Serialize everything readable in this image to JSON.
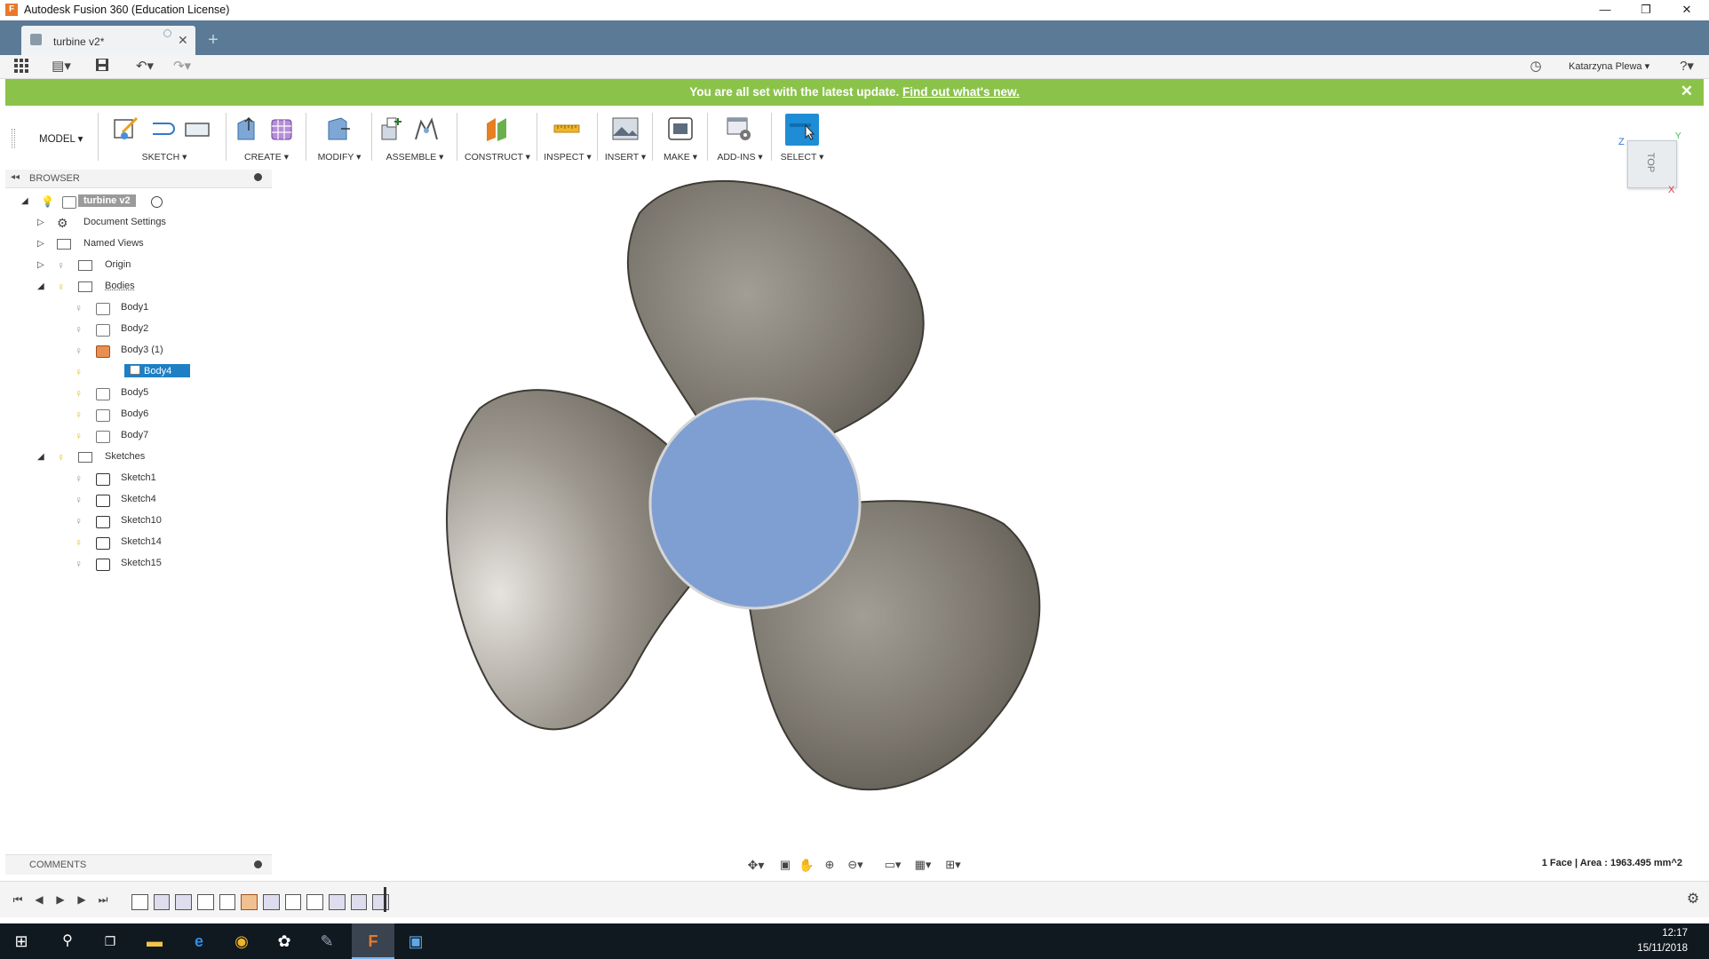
{
  "window": {
    "title": "Autodesk Fusion 360 (Education License)",
    "app_letter": "F"
  },
  "tab": {
    "label": "turbine v2*"
  },
  "user": {
    "name": "Katarzyna Plewa"
  },
  "banner": {
    "message": "You are all set with the latest update.",
    "link": "Find out what's new."
  },
  "ribbon": {
    "workspace": "MODEL",
    "groups": [
      "SKETCH",
      "CREATE",
      "MODIFY",
      "ASSEMBLE",
      "CONSTRUCT",
      "INSPECT",
      "INSERT",
      "MAKE",
      "ADD-INS",
      "SELECT"
    ]
  },
  "browser": {
    "title": "BROWSER",
    "root": "turbine v2",
    "items": [
      {
        "label": "Document Settings"
      },
      {
        "label": "Named Views"
      },
      {
        "label": "Origin"
      },
      {
        "label": "Bodies"
      },
      {
        "label": "Body1"
      },
      {
        "label": "Body2"
      },
      {
        "label": "Body3 (1)"
      },
      {
        "label": "Body4"
      },
      {
        "label": "Body5"
      },
      {
        "label": "Body6"
      },
      {
        "label": "Body7"
      },
      {
        "label": "Sketches"
      },
      {
        "label": "Sketch1"
      },
      {
        "label": "Sketch4"
      },
      {
        "label": "Sketch10"
      },
      {
        "label": "Sketch14"
      },
      {
        "label": "Sketch15"
      }
    ]
  },
  "comments": {
    "title": "COMMENTS"
  },
  "status": {
    "text": "1 Face | Area : 1963.495 mm^2"
  },
  "viewcube": {
    "face": "TOP",
    "axis_z": "Z",
    "axis_x": "X",
    "axis_y": "Y"
  },
  "taskbar": {
    "time": "12:17",
    "date": "15/11/2018"
  },
  "colors": {
    "tab_bar": "#5a7a96",
    "banner": "#8bc34a",
    "selection": "#1f7fc4",
    "hub": "#7f9fd3",
    "blade": "#7d786f"
  }
}
